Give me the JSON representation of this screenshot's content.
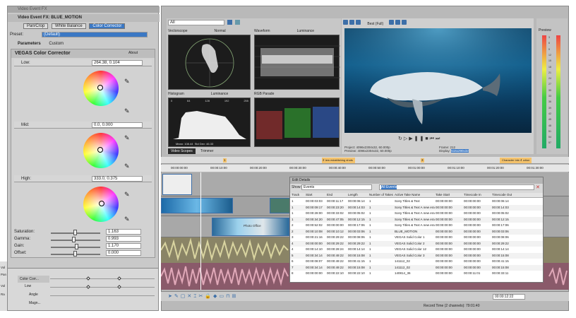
{
  "fx_window": {
    "title": "Video Event FX",
    "header": "Video Event FX: BLUE_MOTION",
    "chain": [
      "Pan/Crop",
      "White Balance",
      "Color Corrector"
    ],
    "preset_label": "Preset:",
    "preset_value": "(Default)",
    "tabs": [
      "Parameters",
      "Custom"
    ],
    "plugin": "VEGAS Color Corrector",
    "about": "About",
    "low_label": "Low:",
    "low_value": "264.38, 0.104",
    "mid_label": "Mid:",
    "mid_value": "0.0, 0.000",
    "high_label": "High:",
    "high_value": "333.0, 0.375",
    "params": [
      {
        "label": "Saturation:",
        "value": "1.163",
        "level": 0.6
      },
      {
        "label": "Gamma:",
        "value": "0.993",
        "level": 0.58
      },
      {
        "label": "Gain:",
        "value": "1.170",
        "level": 0.62
      },
      {
        "label": "Offset:",
        "value": "0.000",
        "level": 0.5
      }
    ],
    "keyframe_rows": [
      "Color Corr...",
      "Low",
      "Angle",
      "Magn..."
    ]
  },
  "scopes": {
    "source": "All",
    "vectorscope": "Vectorscope",
    "vector_mode": "Normal",
    "waveform": "Waveform",
    "wave_mode": "Luminance",
    "histogram": "Histogram",
    "hist_mode": "Luminance",
    "rgb_parade": "RGB Parade",
    "hist_ticks": [
      "0",
      "64",
      "128",
      "192",
      "255"
    ],
    "hist_stats": [
      "Mean: 108.44",
      "Std Dev: 46.33"
    ],
    "tabs": [
      "Video Scopes",
      "Trimmer"
    ]
  },
  "preview": {
    "quality": "Best (Full)",
    "project": "Project: 4096x2304x32, 60.000p",
    "preview_res": "Preview: 4096x2304x32, 60.000p",
    "frame_label": "Frame:",
    "frame_value": "212",
    "display_label": "Display:",
    "display_value": "516x290x32",
    "meter_title": "Preview",
    "meter_ticks": [
      "3",
      "6",
      "9",
      "12",
      "15",
      "18",
      "21",
      "24",
      "27",
      "30",
      "33",
      "36",
      "39",
      "42",
      "45",
      "48",
      "51",
      "54",
      "57"
    ]
  },
  "timeline": {
    "ruler": [
      "00:00:00:00",
      "00:00:10:00",
      "00:00:20:00",
      "00:00:30:00",
      "00:00:40:00",
      "00:00:50:00",
      "00:01:00:00",
      "00:01:10:00",
      "00:01:20:00",
      "00:01:30:00"
    ],
    "markers": [
      "1",
      "2",
      "3",
      "4"
    ],
    "region_a": "New establishing shots",
    "region_b": "Character introduction",
    "clip_title": "Photo Office",
    "side_labels": [
      "Vol",
      "Pan",
      "Vol",
      "Ra"
    ],
    "record_time": "Record Time (2 channels): 79:01:40",
    "time_display": "00:00:12:22"
  },
  "edit_details": {
    "title": "Edit Details",
    "show_label": "Show:",
    "show_value": "Events",
    "filter": "All Events",
    "columns": [
      "Track",
      "Start",
      "End",
      "Length",
      "Number of Takes",
      "Active Take Name",
      "Take Start",
      "Timecode In",
      "Timecode Out"
    ],
    "rows": [
      [
        "1",
        "00:00:03:03",
        "00:00:11:17",
        "00:00:06:14",
        "1",
        "Sony Titles & Text",
        "00:00:00:00",
        "00:00:00:00",
        "00:00:06:14"
      ],
      [
        "1",
        "00:00:09:17",
        "00:00:23:20",
        "00:00:14:03",
        "1",
        "Sony Titles & Text A new era",
        "00:00:00:00",
        "00:00:00:00",
        "00:00:14:03"
      ],
      [
        "1",
        "00:00:28:00",
        "00:00:33:02",
        "00:00:05:02",
        "1",
        "Sony Titles & Text A new era",
        "00:00:00:00",
        "00:00:00:00",
        "00:00:05:02"
      ],
      [
        "1",
        "00:00:34:20",
        "00:00:47:05",
        "00:00:12:15",
        "1",
        "Sony Titles & Text A new era",
        "00:00:00:00",
        "00:00:00:00",
        "00:00:12:15"
      ],
      [
        "2",
        "00:00:52:02",
        "00:00:00:00",
        "00:00:17:06",
        "1",
        "Sony Titles & Text A new era",
        "00:00:00:00",
        "00:00:00:00",
        "00:00:17:06"
      ],
      [
        "2",
        "00:00:10:08",
        "00:00:10:12",
        "00:00:03:06",
        "1",
        "BLUE_MOTION",
        "00:00:00:00",
        "00:00:00:00",
        "00:00:03:06"
      ],
      [
        "3",
        "00:00:21:16",
        "00:00:29:22",
        "00:00:08:06",
        "1",
        "VEGAS Solid Color 1",
        "00:00:00:00",
        "00:00:00:00",
        "00:00:08:06"
      ],
      [
        "4",
        "00:00:00:00",
        "00:00:29:22",
        "00:00:29:22",
        "1",
        "VEGAS Solid Color 2",
        "00:00:00:00",
        "00:00:00:00",
        "00:00:29:22"
      ],
      [
        "4",
        "00:00:14:10",
        "00:00:28:24",
        "00:00:14:14",
        "1",
        "VEGAS Solid Color 12",
        "00:00:00:00",
        "00:00:00:00",
        "00:00:14:14"
      ],
      [
        "5",
        "00:00:34:14",
        "00:00:49:22",
        "00:00:15:08",
        "1",
        "VEGAS Solid Color 3",
        "00:00:00:00",
        "00:00:00:00",
        "00:00:15:08"
      ],
      [
        "6",
        "00:00:08:07",
        "00:00:49:22",
        "00:00:41:15",
        "1",
        "141112_02",
        "00:00:00:00",
        "00:00:00:00",
        "00:00:41:15"
      ],
      [
        "7",
        "00:00:34:14",
        "00:00:49:22",
        "00:00:15:08",
        "1",
        "141112_02",
        "00:00:00:00",
        "00:00:00:00",
        "00:00:15:08"
      ],
      [
        "8",
        "00:00:00:00",
        "00:00:22:10",
        "00:00:22:10",
        "1",
        "140814_36",
        "00:00:00:00",
        "00:00:11:01",
        "00:00:33:11"
      ]
    ]
  },
  "colors": {
    "accent": "#3d6fa8",
    "selection": "#3b78c4",
    "panel": "#c9c9c9",
    "dark": "#1c1c1c"
  }
}
